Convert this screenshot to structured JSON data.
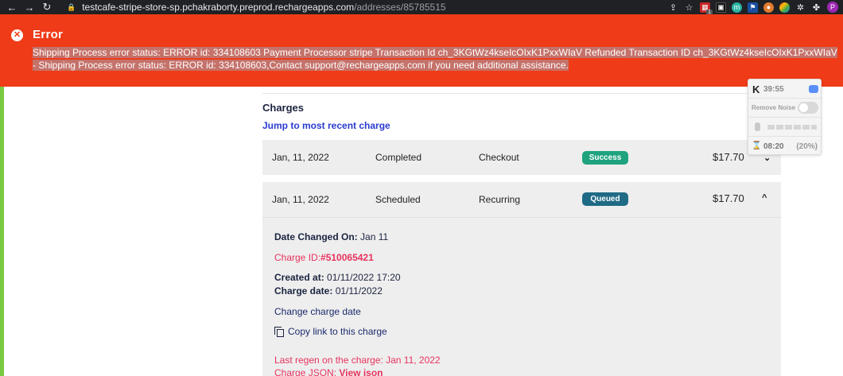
{
  "browser": {
    "url_host": "testcafe-stripe-store-sp.pchakraborty.preprod.rechargeapps.com",
    "url_path": "/addresses/85785515",
    "ext_badge_count": "1",
    "avatar_letter": "P"
  },
  "error": {
    "title": "Error",
    "message": "Shipping Process error status: ERROR id: 334108603 Payment Processor stripe Transaction Id ch_3KGtWz4kseIcOIxK1PxxWIaV Refunded Transaction ID ch_3KGtWz4kseIcOIxK1PxxWIaV - Shipping Process error status: ERROR id: 334108603,Contact support@rechargeapps.com if you need additional assistance."
  },
  "charges": {
    "title": "Charges",
    "jump_link": "Jump to most recent charge",
    "rows": [
      {
        "date": "Jan, 11, 2022",
        "status": "Completed",
        "type": "Checkout",
        "badge": "Success",
        "amount": "$17.70"
      },
      {
        "date": "Jan, 11, 2022",
        "status": "Scheduled",
        "type": "Recurring",
        "badge": "Queued",
        "amount": "$17.70"
      }
    ],
    "details": {
      "date_changed_label": "Date Changed On:",
      "date_changed_value": "Jan 11",
      "charge_id_label": "Charge ID:",
      "charge_id_value": "#510065421",
      "created_label": "Created at:",
      "created_value": "01/11/2022 17:20",
      "charge_date_label": "Charge date:",
      "charge_date_value": "01/11/2022",
      "change_date_link": "Change charge date",
      "copy_link": "Copy link to this charge",
      "last_regen": "Last regen on the charge: Jan 11, 2022",
      "json_label": "Charge JSON:",
      "json_link": "View json"
    }
  },
  "widget": {
    "logo": "K",
    "timer": "39:55",
    "noise_label": "Remove Noise",
    "eta": "08:20",
    "percent": "(20%)"
  },
  "colors": {
    "error_bg": "#ef3b17",
    "success": "#1fa37f",
    "queued": "#1f6b86",
    "link_blue": "#2a3bd1",
    "pink": "#e8335d"
  }
}
